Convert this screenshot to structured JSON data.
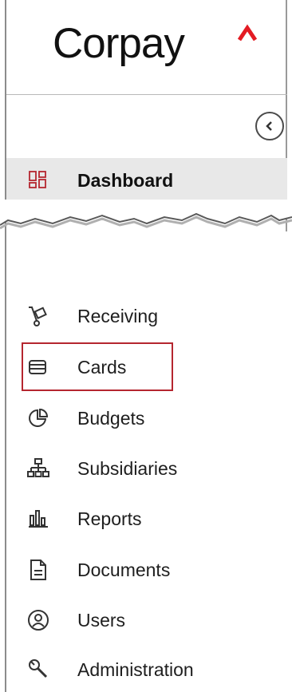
{
  "brand": {
    "name": "Corpay",
    "accent": "#e31b23"
  },
  "sidebar": {
    "collapse_icon": "chevron-left-circle-icon",
    "active_item": {
      "label": "Dashboard",
      "icon": "dashboard-grid-icon"
    },
    "items": [
      {
        "label": "Receiving",
        "icon": "receiving-cart-icon"
      },
      {
        "label": "Cards",
        "icon": "cards-stack-icon"
      },
      {
        "label": "Budgets",
        "icon": "budget-pie-icon"
      },
      {
        "label": "Subsidiaries",
        "icon": "org-chart-icon"
      },
      {
        "label": "Reports",
        "icon": "bar-chart-icon"
      },
      {
        "label": "Documents",
        "icon": "document-icon"
      },
      {
        "label": "Users",
        "icon": "user-circle-icon"
      },
      {
        "label": "Administration",
        "icon": "wrench-icon"
      }
    ]
  },
  "annotation": {
    "highlight_color": "#b5262f"
  }
}
